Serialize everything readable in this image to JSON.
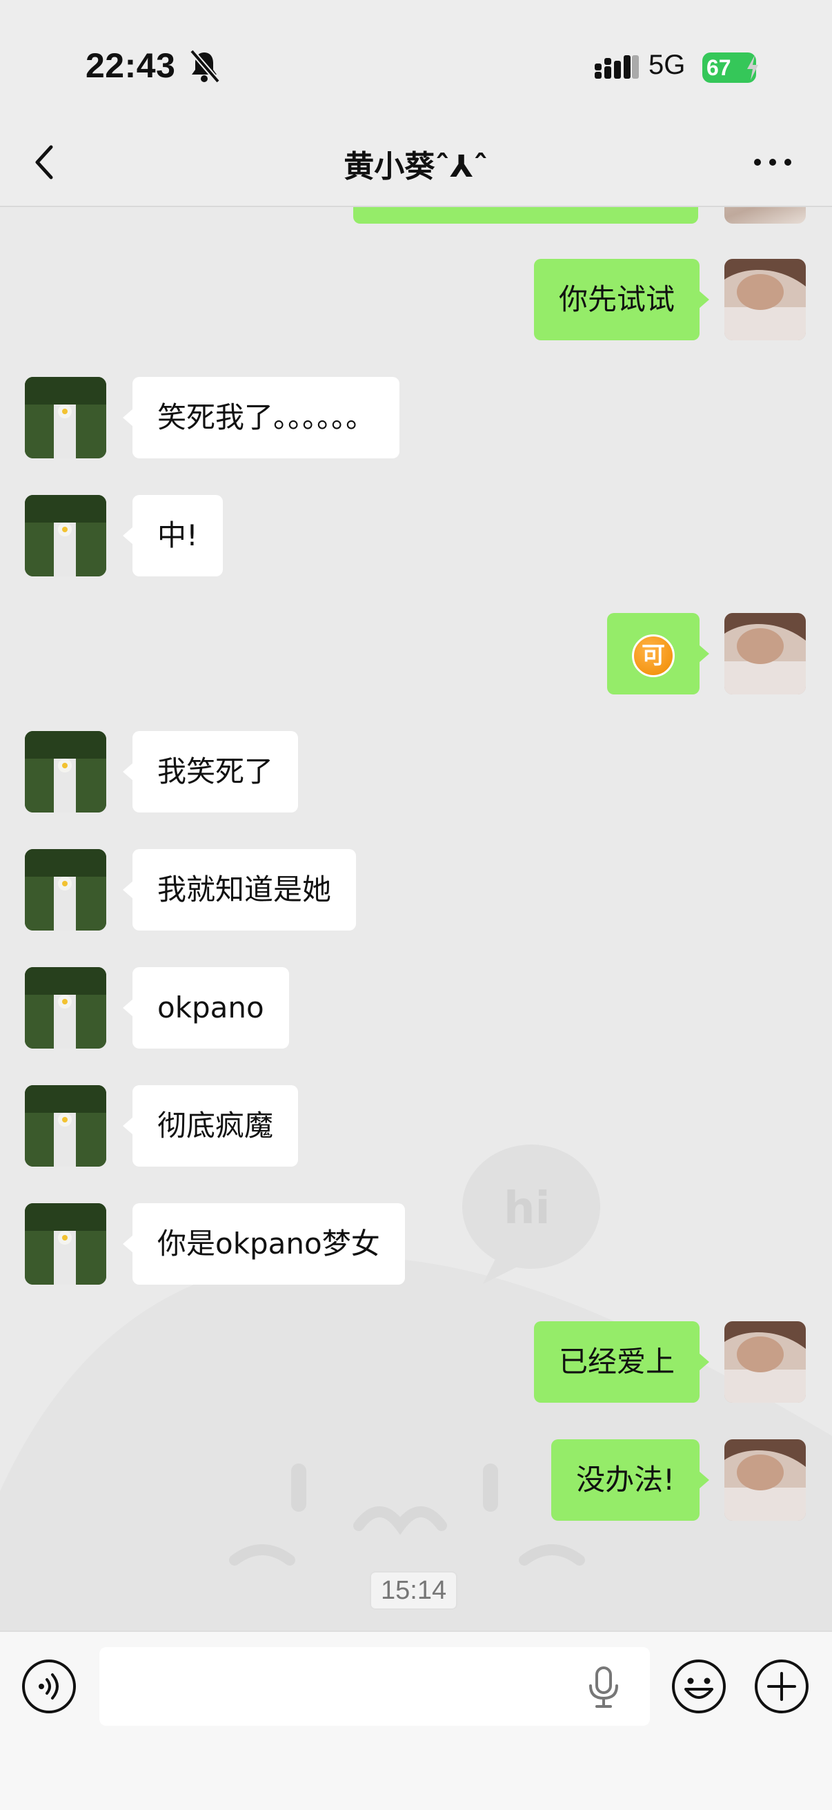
{
  "status_bar": {
    "time": "22:43",
    "network": "5G",
    "battery": "67"
  },
  "nav": {
    "title": "黄小葵ˆ⅄ˆ"
  },
  "messages": [
    {
      "side": "right",
      "text": "你先试试"
    },
    {
      "side": "left",
      "text": "笑死我了。。。。。。"
    },
    {
      "side": "left",
      "text": "中!"
    },
    {
      "side": "right",
      "emoji": "可"
    },
    {
      "side": "left",
      "text": "我笑死了"
    },
    {
      "side": "left",
      "text": "我就知道是她"
    },
    {
      "side": "left",
      "text": "okpano"
    },
    {
      "side": "left",
      "text": "彻底疯魔"
    },
    {
      "side": "left",
      "text": "你是okpano梦女"
    },
    {
      "side": "right",
      "text": "已经爱上"
    },
    {
      "side": "right",
      "text": "没办法!"
    }
  ],
  "time_divider": "15:14",
  "wallpaper_text": "hi",
  "input_bar": {
    "value": "",
    "placeholder": ""
  },
  "colors": {
    "sent_bubble": "#95ec69",
    "received_bubble": "#ffffff",
    "background": "#ededed",
    "battery": "#35c759"
  },
  "icons": [
    "bell-muted-icon",
    "signal-icon",
    "battery-icon",
    "back-icon",
    "more-icon",
    "voice-icon",
    "mic-icon",
    "emoji-icon",
    "plus-icon"
  ]
}
